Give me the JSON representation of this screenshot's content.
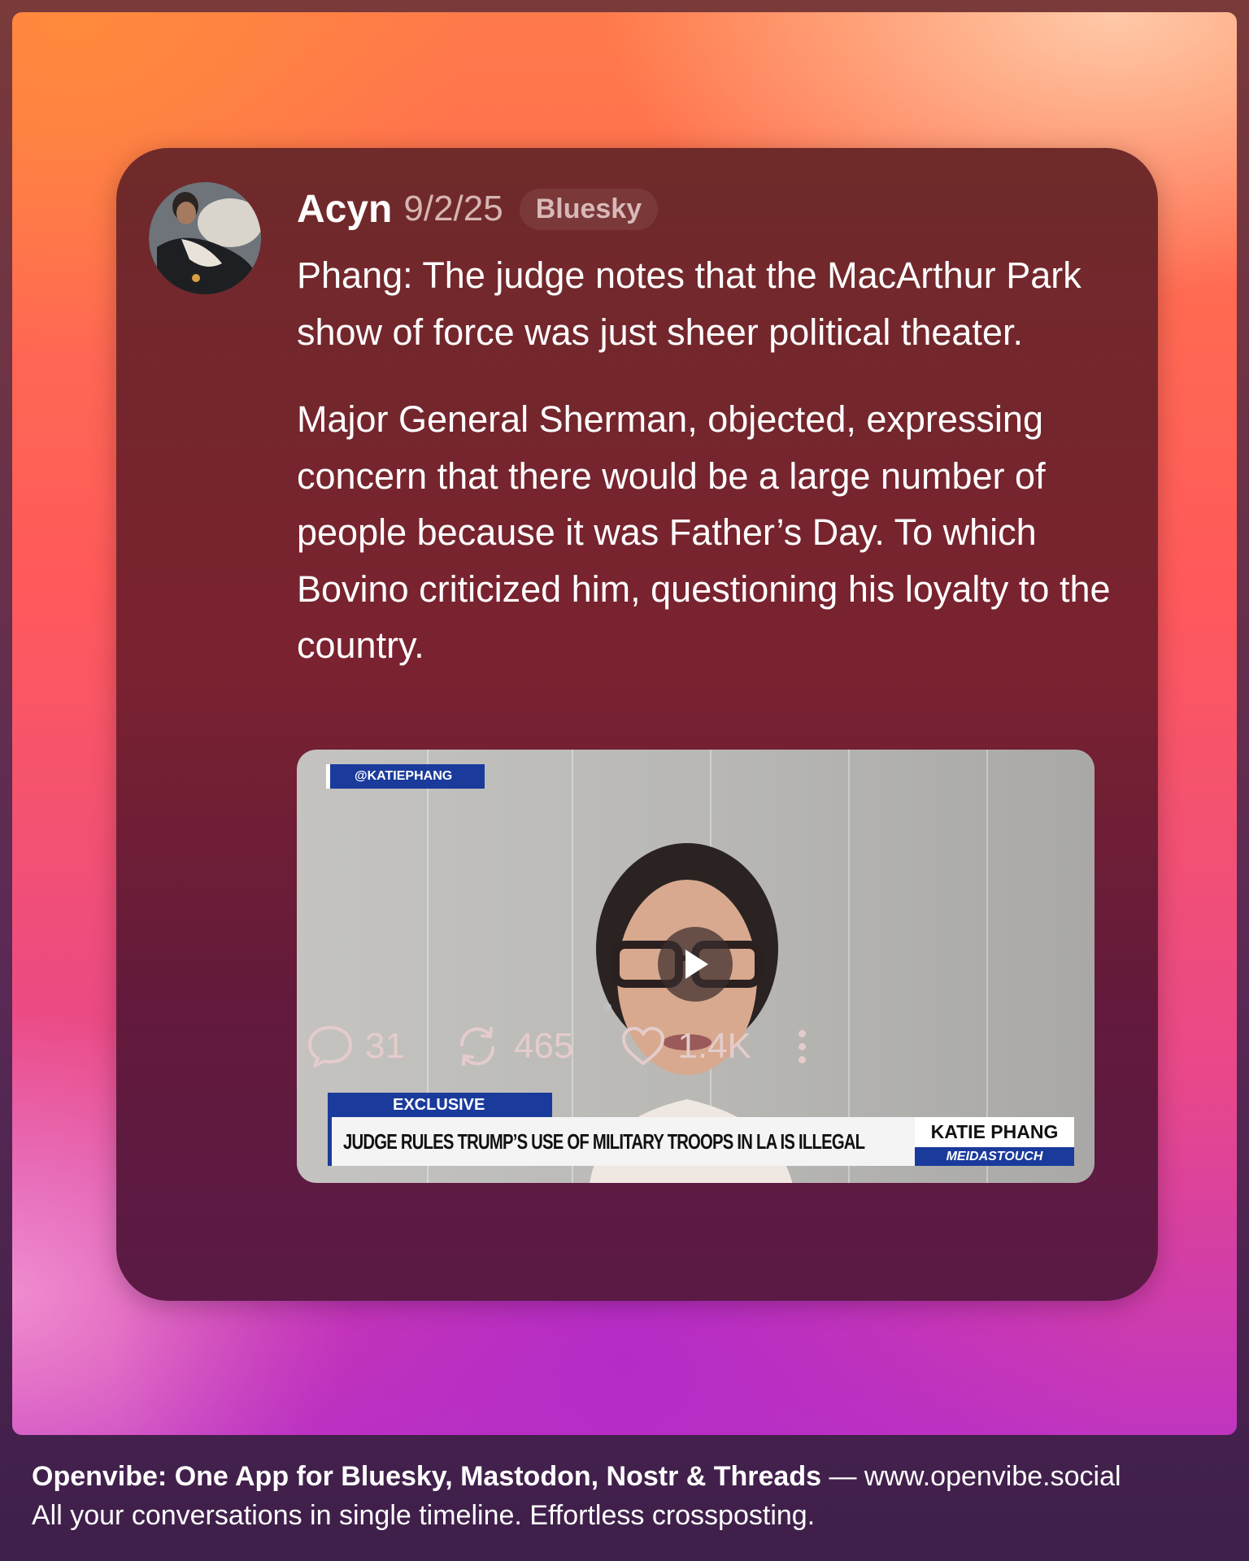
{
  "post": {
    "author": "Acyn",
    "date": "9/2/25",
    "platform": "Bluesky",
    "paragraphs": [
      "Phang: The judge notes that the MacArthur Park show of force was just sheer political theater.",
      "Major General Sherman, objected, expressing concern that there would be a large number of people because it was Father’s Day. To which Bovino criticized him, questioning his loyalty to the country."
    ]
  },
  "video": {
    "handle_tag": "@KATIEPHANG",
    "label": "EXCLUSIVE",
    "headline": "JUDGE RULES TRUMP’S USE OF MILITARY TROOPS IN LA IS ILLEGAL",
    "name": "KATIE PHANG",
    "org": "MEIDASTOUCH",
    "play_icon": "play-icon"
  },
  "actions": {
    "replies": "31",
    "reposts": "465",
    "likes": "1.4K"
  },
  "footer": {
    "tagline": "Openvibe: One App for Bluesky, Mastodon, Nostr & Threads",
    "separator": " — ",
    "url": "www.openvibe.social",
    "subtext": "All your conversations in single timeline. Effortless crossposting."
  },
  "colors": {
    "card": "#7a2230",
    "broadcast_blue": "#1a3a9c",
    "action_text": "#e5cccc"
  }
}
